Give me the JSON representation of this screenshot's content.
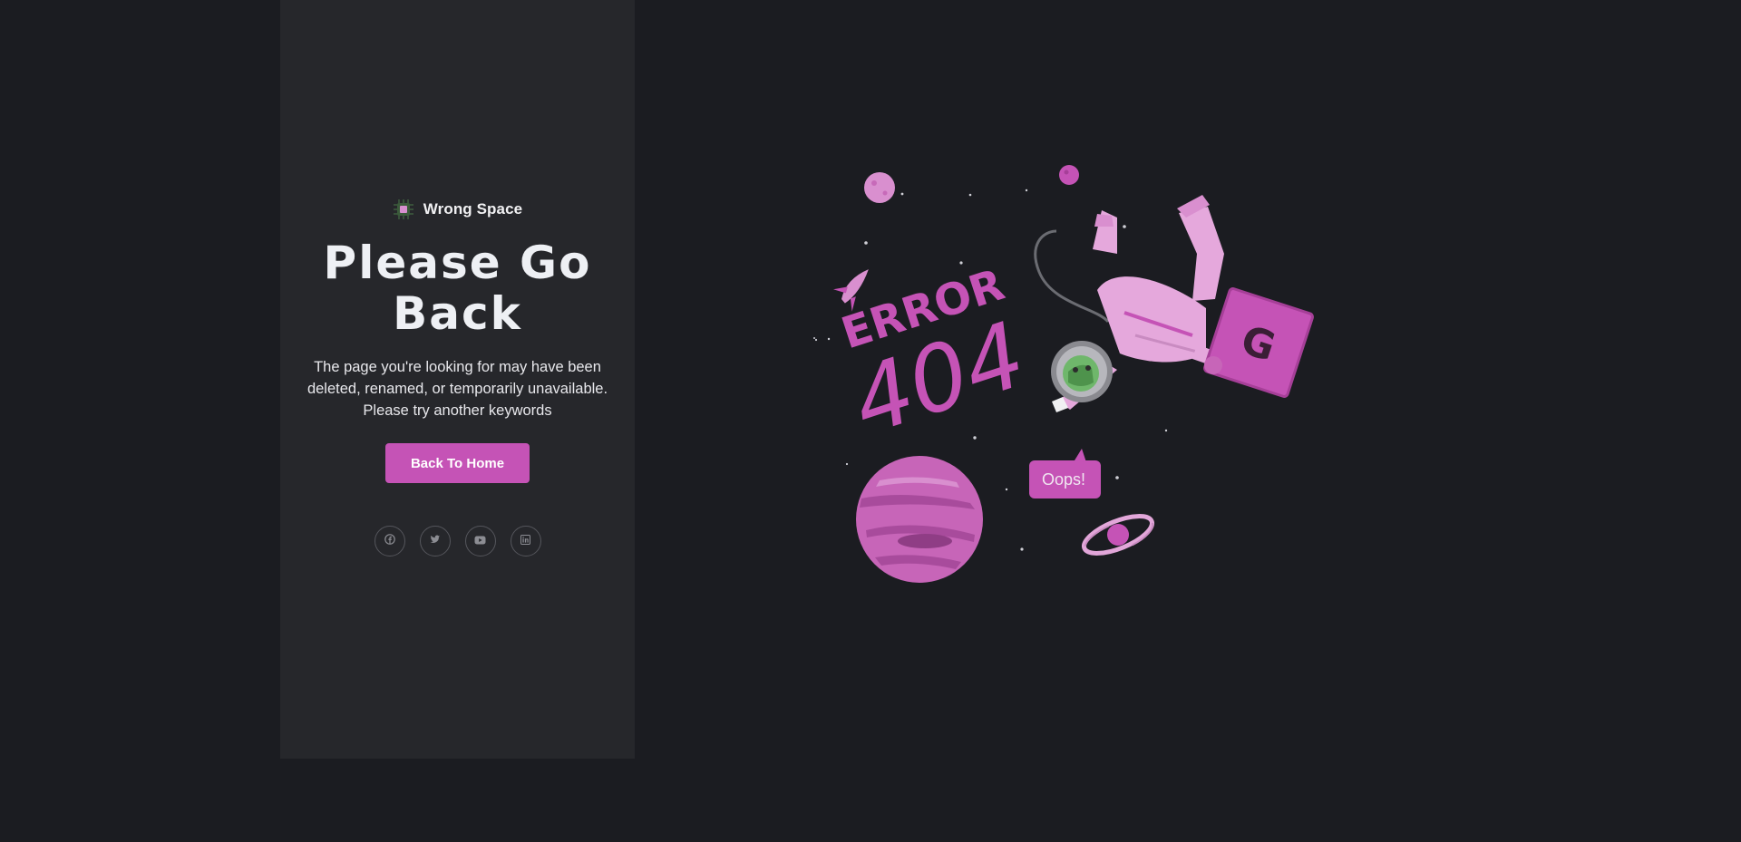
{
  "brand": {
    "name": "Wrong Space",
    "logo_icon": "chip-icon"
  },
  "hero": {
    "title_line1": "Please Go",
    "title_line2": "Back",
    "subtitle_line1": "The page you're looking for may have been",
    "subtitle_line2": "deleted, renamed, or temporarily unavailable.",
    "subtitle_line3": "Please try another keywords"
  },
  "actions": {
    "home_label": "Back To Home"
  },
  "socials": [
    {
      "icon": "facebook-icon"
    },
    {
      "icon": "twitter-icon"
    },
    {
      "icon": "youtube-icon"
    },
    {
      "icon": "linkedin-icon"
    }
  ],
  "illustration": {
    "error_word": "ERROR",
    "error_code": "404",
    "speech": "Oops!",
    "box_letter": "G"
  },
  "colors": {
    "accent": "#c553b6",
    "page_bg": "#1b1c21",
    "panel_bg": "#26272b",
    "planet": "#c765b8",
    "suit": "#e5a8dc"
  }
}
